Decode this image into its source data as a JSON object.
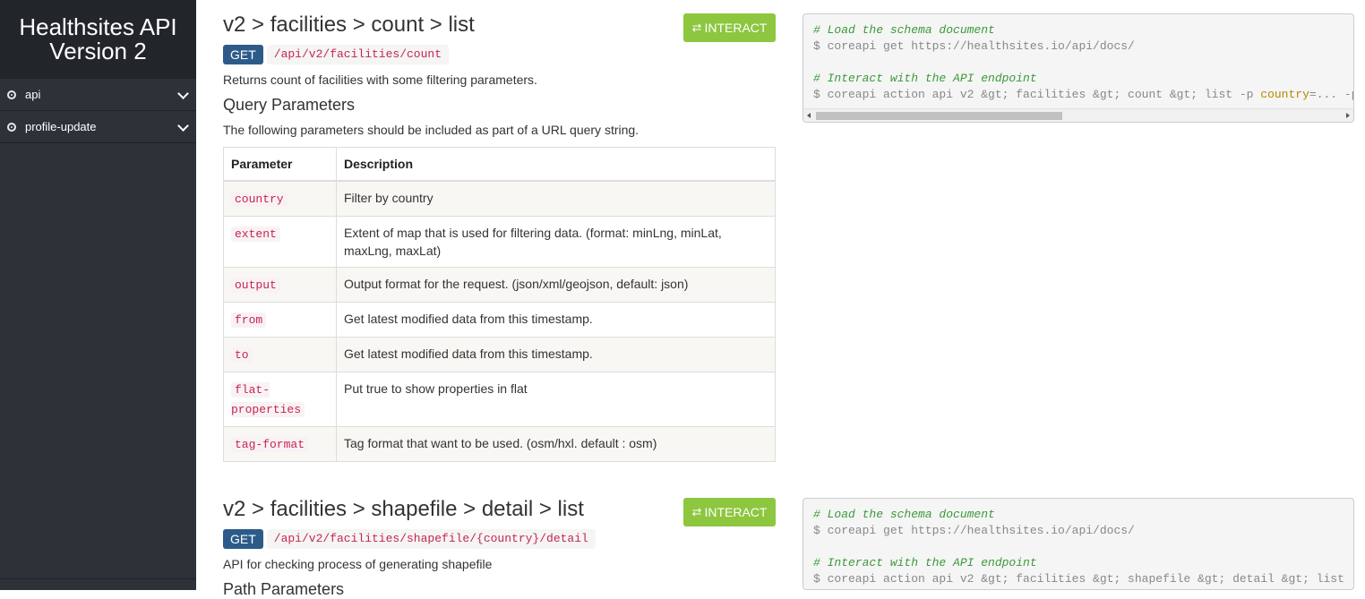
{
  "sidebar": {
    "title_line1": "Healthsites API",
    "title_line2": "Version 2",
    "items": [
      {
        "label": "api"
      },
      {
        "label": "profile-update"
      }
    ]
  },
  "sections": [
    {
      "title": "v2 > facilities > count > list",
      "interact_label": "INTERACT",
      "method": "GET",
      "path": "/api/v2/facilities/count",
      "description": "Returns count of facilities with some filtering parameters.",
      "query_heading": "Query Parameters",
      "query_text": "The following parameters should be included as part of a URL query string.",
      "table_headers": [
        "Parameter",
        "Description"
      ],
      "params": [
        {
          "name": "country",
          "desc": "Filter by country"
        },
        {
          "name": "extent",
          "desc": "Extent of map that is used for filtering data. (format: minLng, minLat, maxLng, maxLat)"
        },
        {
          "name": "output",
          "desc": "Output format for the request. (json/xml/geojson, default: json)"
        },
        {
          "name": "from",
          "desc": "Get latest modified data from this timestamp."
        },
        {
          "name": "to",
          "desc": "Get latest modified data from this timestamp."
        },
        {
          "name": "flat-properties",
          "desc": "Put true to show properties in flat"
        },
        {
          "name": "tag-format",
          "desc": "Tag format that want to be used. (osm/hxl. default : osm)"
        }
      ],
      "code": {
        "comment1": "# Load the schema document",
        "line1": "$ coreapi get https://healthsites.io/api/docs/",
        "comment2": "# Interact with the API endpoint",
        "line2_pre": "$ coreapi action api v2 &gt; facilities &gt; count &gt; list -p ",
        "line2_hl": "country",
        "line2_post": "=... -p"
      }
    },
    {
      "title": "v2 > facilities > shapefile > detail > list",
      "interact_label": "INTERACT",
      "method": "GET",
      "path": "/api/v2/facilities/shapefile/{country}/detail",
      "description": "API for checking process of generating shapefile",
      "next_heading": "Path Parameters",
      "code": {
        "comment1": "# Load the schema document",
        "line1": "$ coreapi get https://healthsites.io/api/docs/",
        "comment2": "# Interact with the API endpoint",
        "line2": "$ coreapi action api v2 &gt; facilities &gt; shapefile &gt; detail &gt; list -"
      }
    }
  ]
}
